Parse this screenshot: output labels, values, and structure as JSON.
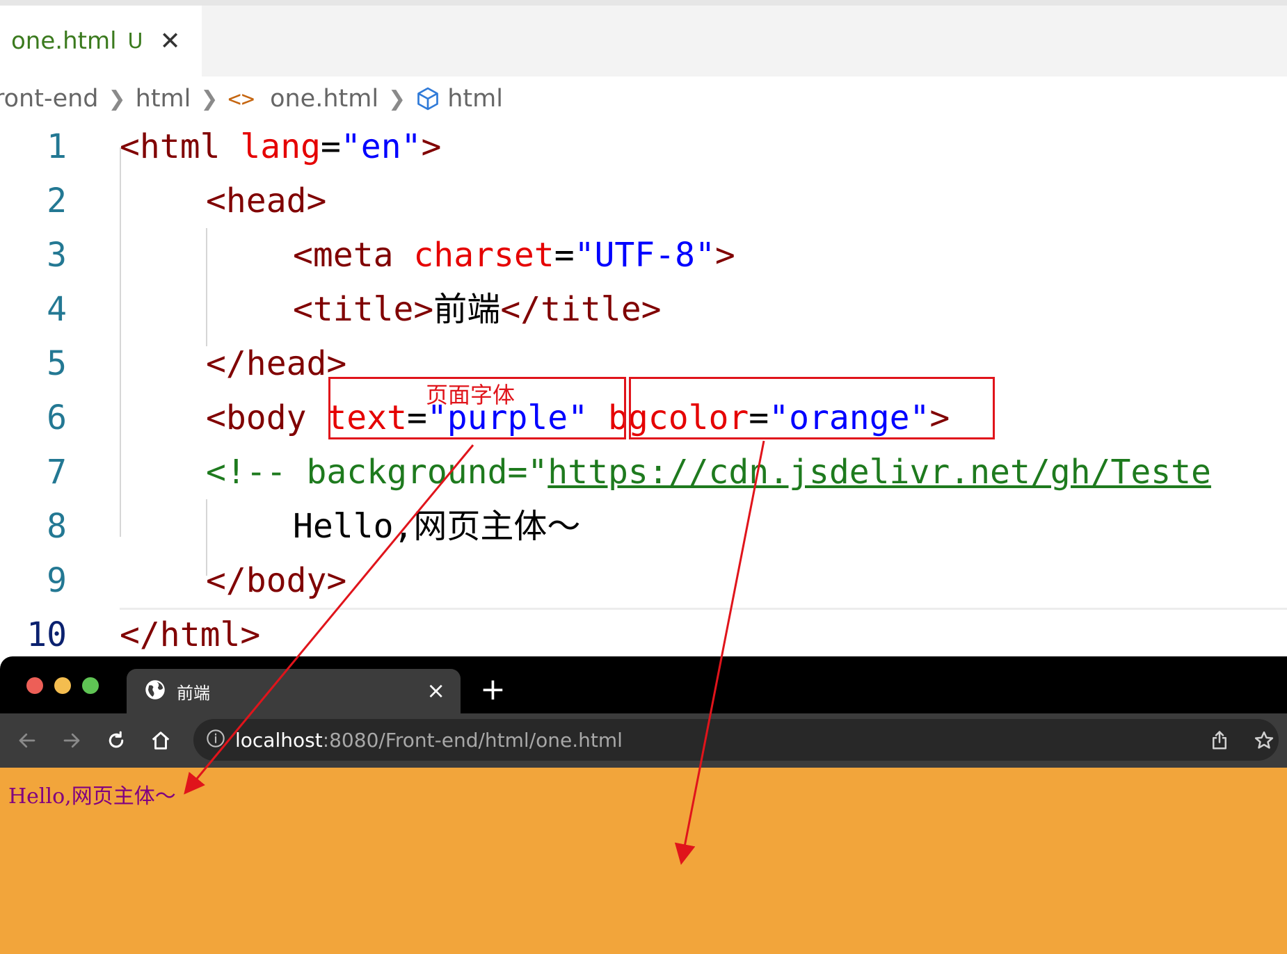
{
  "editor": {
    "tab": {
      "filename": "one.html",
      "status": "U"
    },
    "breadcrumb": {
      "items": [
        "ront-end",
        "html",
        "one.html",
        "html"
      ],
      "code_glyph": "<>"
    },
    "line_numbers": [
      "1",
      "2",
      "3",
      "4",
      "5",
      "6",
      "7",
      "8",
      "9",
      "10"
    ],
    "lines": {
      "l1": {
        "open": "<html",
        "attr": "lang",
        "eq": "=",
        "val": "\"en\"",
        "close": ">"
      },
      "l2": {
        "text": "<head>"
      },
      "l3": {
        "open": "<meta",
        "attr": "charset",
        "eq": "=",
        "val": "\"UTF-8\"",
        "close": ">"
      },
      "l4": {
        "open": "<title>",
        "text": "前端",
        "close": "</title>"
      },
      "l5": {
        "text": "</head>"
      },
      "l6": {
        "open": "<body",
        "attr1": "text",
        "eq1": "=",
        "val1": "\"purple\"",
        "attr2": "bgcolor",
        "eq2": "=",
        "val2": "\"orange\"",
        "close": ">"
      },
      "l7": {
        "comment": "<!-- background=\"",
        "url": "https://cdn.jsdelivr.net/gh/Teste"
      },
      "l8": {
        "text": "Hello,网页主体～"
      },
      "l9": {
        "text": "</body>"
      },
      "l10": {
        "text": "</html>"
      }
    }
  },
  "annotation": {
    "label": "页面字体",
    "color": "#e0141b"
  },
  "browser": {
    "tab_title": "前端",
    "close_glyph": "×",
    "newtab_glyph": "+",
    "url_host": "localhost",
    "url_rest": ":8080/Front-end/html/one.html",
    "page_text": "Hello,网页主体～",
    "page_bgcolor": "#f2a53b",
    "page_textcolor": "#800080",
    "icons": [
      "back-icon",
      "forward-icon",
      "reload-icon",
      "home-icon",
      "info-icon",
      "share-icon",
      "bookmark-star-icon",
      "globe-icon"
    ]
  },
  "traffic_lights": [
    "#ed5f57",
    "#f4bd4f",
    "#5fc454"
  ]
}
